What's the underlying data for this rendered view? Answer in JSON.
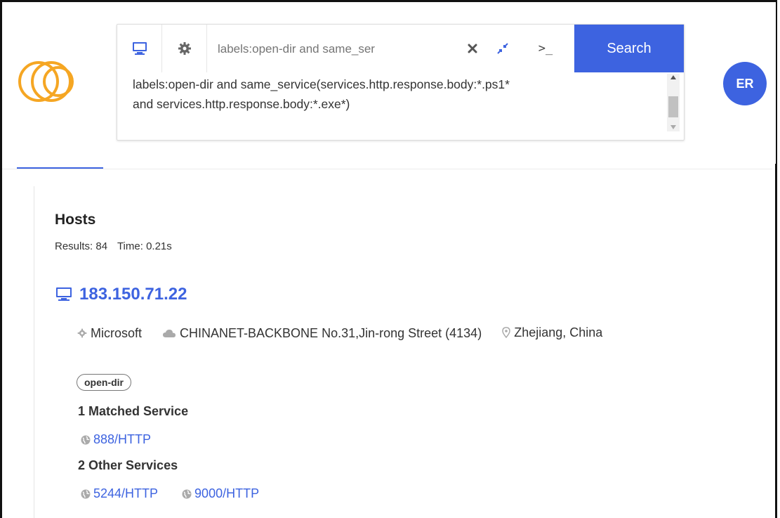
{
  "header": {
    "avatar_initials": "ER",
    "brand_color": "#3d63e0",
    "logo_color": "#f5a623"
  },
  "search": {
    "placeholder": "labels:open-dir and same_ser",
    "button_label": "Search",
    "console_glyph": ">_",
    "query": "labels:open-dir and same_service(services.http.response.body:*.ps1* and services.http.response.body:*.exe*)",
    "query_line1": "labels:open-dir and same_service(services.http.response.body:*.ps1*",
    "query_line2": "and services.http.response.body:*.exe*)"
  },
  "results": {
    "section_title": "Hosts",
    "results_label": "Results: 84",
    "time_label": "Time: 0.21s"
  },
  "host": {
    "ip": "183.150.71.22",
    "os": "Microsoft",
    "network": "CHINANET-BACKBONE No.31,Jin-rong Street (4134)",
    "location": "Zhejiang, China",
    "label": "open-dir",
    "matched_title": "1 Matched Service",
    "matched_services": [
      "888/HTTP"
    ],
    "other_title": "2 Other Services",
    "other_services": [
      "5244/HTTP",
      "9000/HTTP"
    ]
  },
  "icons": {
    "mode": "desktop-icon",
    "settings": "gear-icon",
    "clear": "close-icon",
    "collapse": "collapse-icon",
    "console": "terminal-icon",
    "os": "gear-icon",
    "network": "cloud-icon",
    "location": "map-pin-icon",
    "service": "globe-icon"
  }
}
